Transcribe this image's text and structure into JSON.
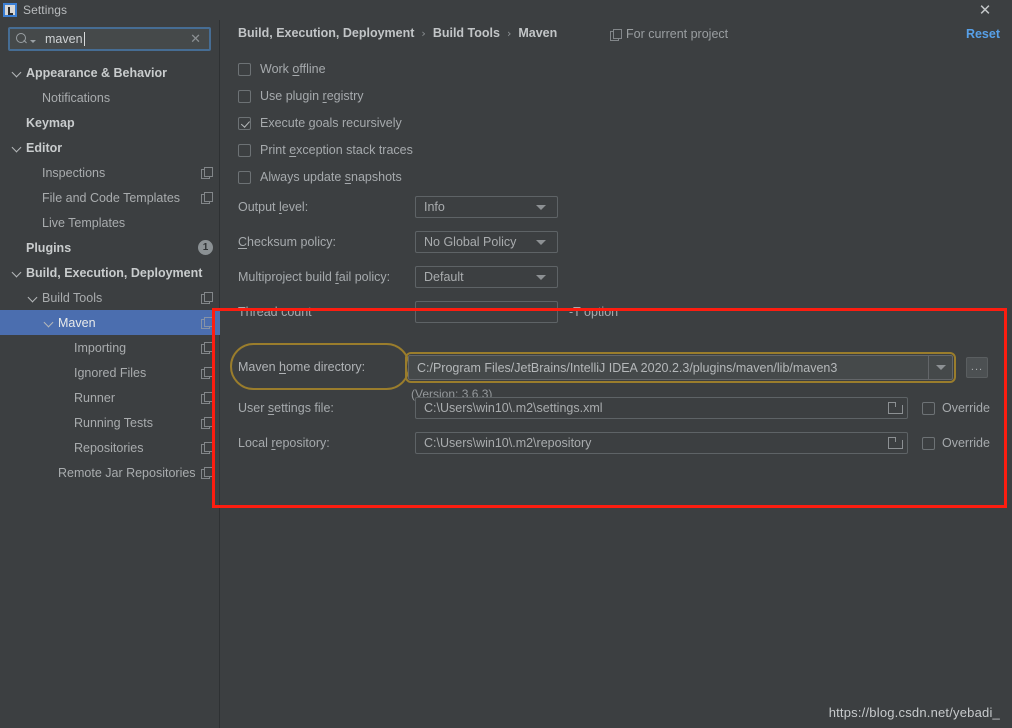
{
  "window": {
    "title": "Settings",
    "app_icon": "intellij-idea-icon",
    "close_icon": "close-icon"
  },
  "sidebar": {
    "search": {
      "value": "maven",
      "placeholder": "",
      "search_icon": "search-icon",
      "clear_icon": "clear-icon"
    },
    "items": [
      {
        "label": "Appearance & Behavior",
        "indent": 0,
        "bold": true,
        "chevron": true,
        "copy": false,
        "selected": false,
        "badge": ""
      },
      {
        "label": "Notifications",
        "indent": 1,
        "bold": false,
        "chevron": false,
        "copy": false,
        "selected": false,
        "badge": ""
      },
      {
        "label": "Keymap",
        "indent": 0,
        "bold": true,
        "chevron": false,
        "copy": false,
        "selected": false,
        "badge": ""
      },
      {
        "label": "Editor",
        "indent": 0,
        "bold": true,
        "chevron": true,
        "copy": false,
        "selected": false,
        "badge": ""
      },
      {
        "label": "Inspections",
        "indent": 1,
        "bold": false,
        "chevron": false,
        "copy": true,
        "selected": false,
        "badge": ""
      },
      {
        "label": "File and Code Templates",
        "indent": 1,
        "bold": false,
        "chevron": false,
        "copy": true,
        "selected": false,
        "badge": ""
      },
      {
        "label": "Live Templates",
        "indent": 1,
        "bold": false,
        "chevron": false,
        "copy": false,
        "selected": false,
        "badge": ""
      },
      {
        "label": "Plugins",
        "indent": 0,
        "bold": true,
        "chevron": false,
        "copy": false,
        "selected": false,
        "badge": "1"
      },
      {
        "label": "Build, Execution, Deployment",
        "indent": 0,
        "bold": true,
        "chevron": true,
        "copy": false,
        "selected": false,
        "badge": ""
      },
      {
        "label": "Build Tools",
        "indent": 1,
        "bold": false,
        "chevron": true,
        "copy": true,
        "selected": false,
        "badge": ""
      },
      {
        "label": "Maven",
        "indent": 2,
        "bold": false,
        "chevron": true,
        "copy": true,
        "selected": true,
        "badge": ""
      },
      {
        "label": "Importing",
        "indent": 3,
        "bold": false,
        "chevron": false,
        "copy": true,
        "selected": false,
        "badge": ""
      },
      {
        "label": "Ignored Files",
        "indent": 3,
        "bold": false,
        "chevron": false,
        "copy": true,
        "selected": false,
        "badge": ""
      },
      {
        "label": "Runner",
        "indent": 3,
        "bold": false,
        "chevron": false,
        "copy": true,
        "selected": false,
        "badge": ""
      },
      {
        "label": "Running Tests",
        "indent": 3,
        "bold": false,
        "chevron": false,
        "copy": true,
        "selected": false,
        "badge": ""
      },
      {
        "label": "Repositories",
        "indent": 3,
        "bold": false,
        "chevron": false,
        "copy": true,
        "selected": false,
        "badge": ""
      },
      {
        "label": "Remote Jar Repositories",
        "indent": 2,
        "bold": false,
        "chevron": false,
        "copy": true,
        "selected": false,
        "badge": ""
      }
    ]
  },
  "header": {
    "breadcrumb": [
      "Build, Execution, Deployment",
      "Build Tools",
      "Maven"
    ],
    "separator": "›",
    "scope_note": "For current project",
    "scope_icon": "copy-scope-icon",
    "reset_label": "Reset"
  },
  "main": {
    "checkboxes": [
      {
        "label_pre": "Work ",
        "label_mnemonic": "o",
        "label_post": "ffline",
        "checked": false
      },
      {
        "label_pre": "Use plugin ",
        "label_mnemonic": "r",
        "label_post": "egistry",
        "checked": false
      },
      {
        "label_pre": "Execute ",
        "label_mnemonic": "g",
        "label_post": "oals recursively",
        "checked": true
      },
      {
        "label_pre": "Print ",
        "label_mnemonic": "e",
        "label_post": "xception stack traces",
        "checked": false
      },
      {
        "label_pre": "Always update ",
        "label_mnemonic": "s",
        "label_post": "napshots",
        "checked": false
      }
    ],
    "output_level": {
      "label_pre": "Output ",
      "label_mnemonic": "l",
      "label_post": "evel:",
      "value": "Info"
    },
    "checksum_policy": {
      "label_pre": "",
      "label_mnemonic": "C",
      "label_post": "hecksum policy:",
      "value": "No Global Policy"
    },
    "multiproject_fail_policy": {
      "label_pre": "Multiproject build ",
      "label_mnemonic": "f",
      "label_post": "ail policy:",
      "value": "Default"
    },
    "thread_count": {
      "label": "Thread count",
      "value": "",
      "hint": "-T option"
    },
    "maven_home": {
      "label_pre": "Maven ",
      "label_mnemonic": "h",
      "label_post": "ome directory:",
      "value": "C:/Program Files/JetBrains/IntelliJ IDEA 2020.2.3/plugins/maven/lib/maven3",
      "version_note": "(Version: 3.6.3)",
      "dropdown_icon": "chevron-down-icon",
      "browse_label": "...",
      "highlight_color": "#9a7d2c"
    },
    "user_settings_file": {
      "label_pre": "User ",
      "label_mnemonic": "s",
      "label_post": "ettings file:",
      "value": "C:\\Users\\win10\\.m2\\settings.xml",
      "folder_icon": "folder-icon",
      "override_label": "Override",
      "override_checked": false
    },
    "local_repository": {
      "label_pre": "Local ",
      "label_mnemonic": "r",
      "label_post": "epository:",
      "value": "C:\\Users\\win10\\.m2\\repository",
      "folder_icon": "folder-icon",
      "override_label": "Override",
      "override_checked": false
    }
  },
  "annotation": {
    "red_box_color": "#fd1d10"
  },
  "watermark": "https://blog.csdn.net/yebadi_"
}
